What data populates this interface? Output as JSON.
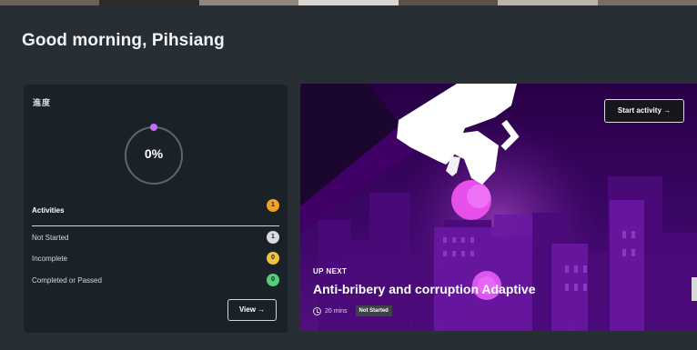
{
  "greeting": "Good morning, Pihsiang",
  "progress": {
    "label": "進度",
    "percent_text": "0%",
    "value": 0,
    "activities_label": "Activities",
    "total_badge": "1",
    "rows": [
      {
        "label": "Not Started",
        "count": "1"
      },
      {
        "label": "Incomplete",
        "count": "0"
      },
      {
        "label": "Completed or Passed",
        "count": "0"
      }
    ],
    "view_label": "View →"
  },
  "hero": {
    "start_label": "Start activity →",
    "up_next": "UP NEXT",
    "title": "Anti-bribery and corruption Adaptive",
    "duration": "20 mins",
    "status": "Not Started"
  },
  "icons": [
    "progress-ring-icon",
    "clock-icon",
    "hand-coin-illustration"
  ],
  "colors": {
    "background": "#272e34",
    "card": "#1a2128",
    "accent_purple": "#b85be8",
    "orange_badge": "#f3a124",
    "grey_badge": "#d8dce0",
    "yellow_badge": "#f4c13f",
    "green_badge": "#55cf75"
  }
}
